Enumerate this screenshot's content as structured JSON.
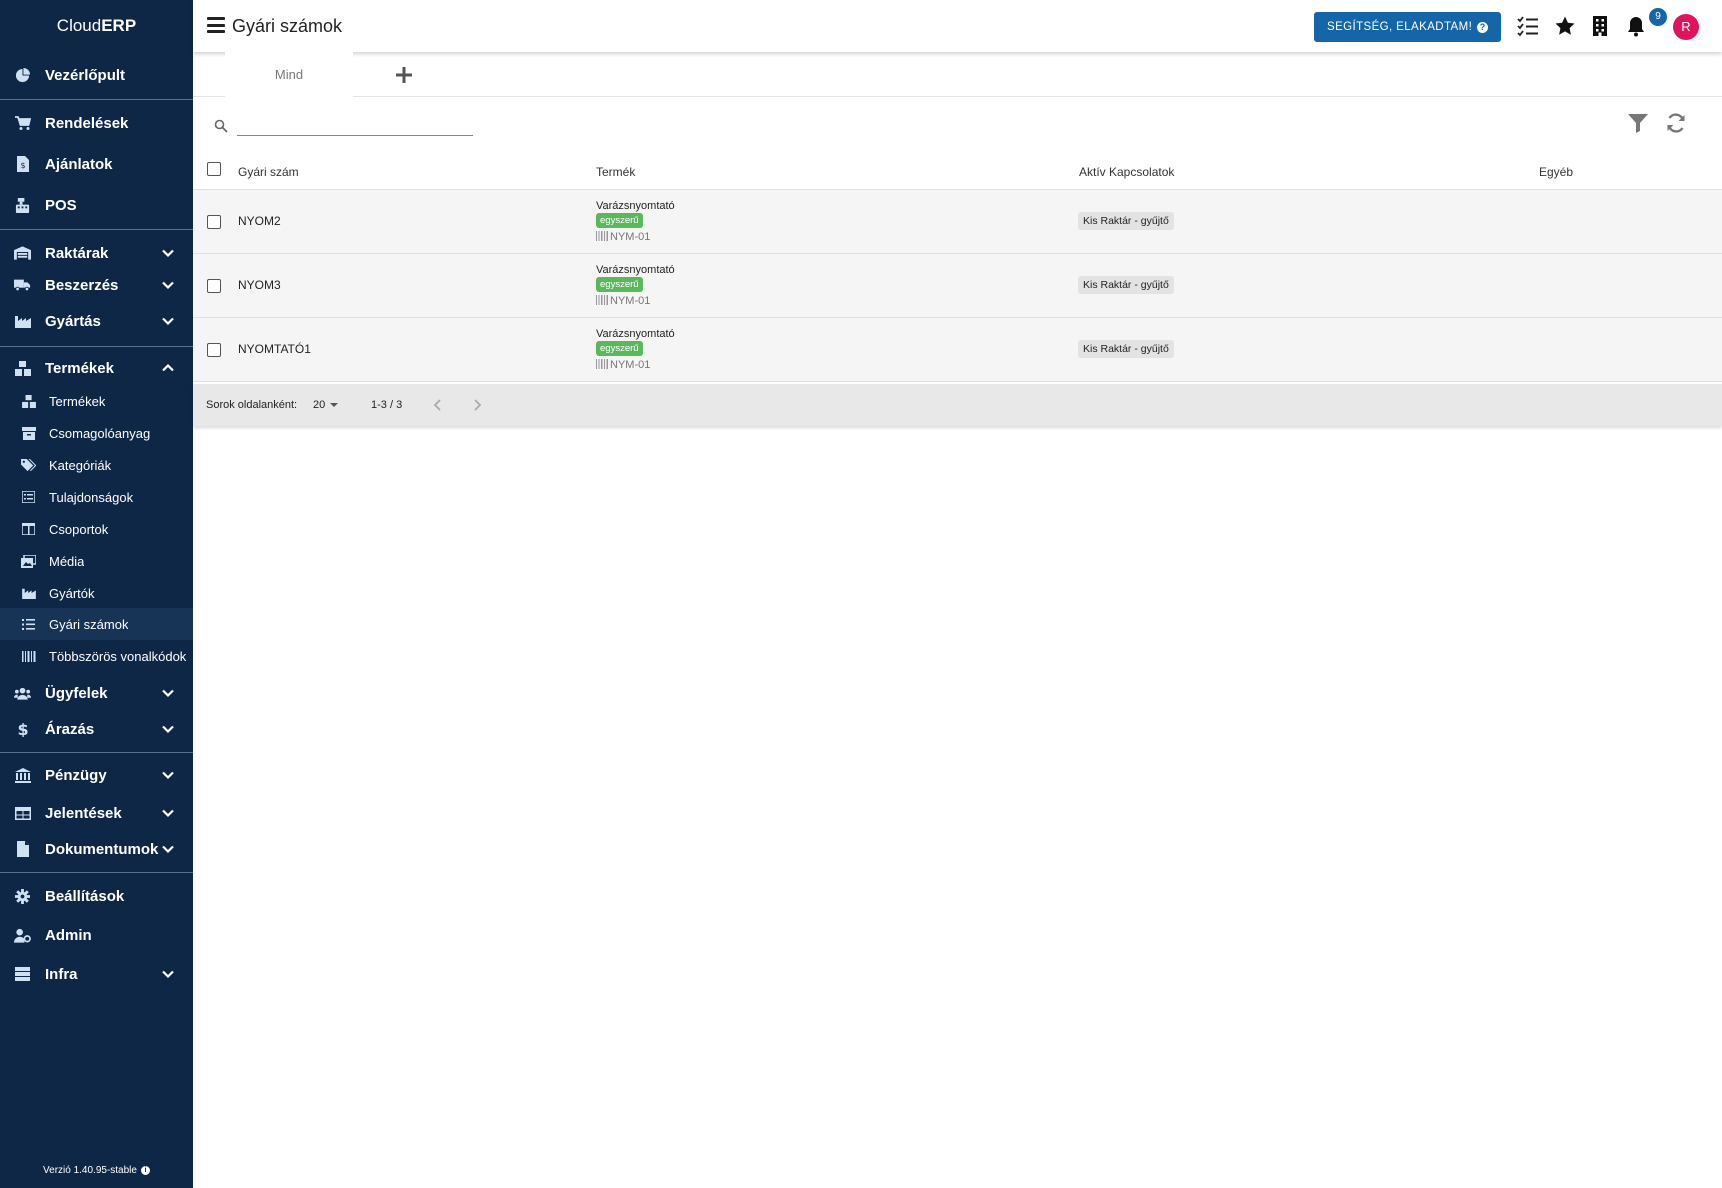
{
  "brand": {
    "prefix": "Cloud",
    "bold": "ERP"
  },
  "sidebar": {
    "items": [
      {
        "label": "Vezérlőpult"
      },
      {
        "label": "Rendelések"
      },
      {
        "label": "Ajánlatok"
      },
      {
        "label": "POS"
      },
      {
        "label": "Raktárak"
      },
      {
        "label": "Beszerzés"
      },
      {
        "label": "Gyártás"
      },
      {
        "label": "Termékek"
      },
      {
        "label": "Ügyfelek"
      },
      {
        "label": "Árazás"
      },
      {
        "label": "Pénzügy"
      },
      {
        "label": "Jelentések"
      },
      {
        "label": "Dokumentumok"
      },
      {
        "label": "Beállítások"
      },
      {
        "label": "Admin"
      },
      {
        "label": "Infra"
      }
    ],
    "sub_items": [
      {
        "label": "Termékek"
      },
      {
        "label": "Csomagolóanyag"
      },
      {
        "label": "Kategóriák"
      },
      {
        "label": "Tulajdonságok"
      },
      {
        "label": "Csoportok"
      },
      {
        "label": "Média"
      },
      {
        "label": "Gyártók"
      },
      {
        "label": "Gyári számok"
      },
      {
        "label": "Többszörös vonalkódok"
      }
    ],
    "version": "Verzió 1.40.95-stable"
  },
  "header": {
    "title": "Gyári számok",
    "help_label": "SEGÍTSÉG, ELAKADTAM!",
    "notification_count": "9",
    "avatar_letter": "R"
  },
  "tabs": [
    {
      "label": "Mind"
    }
  ],
  "search": {
    "placeholder": ""
  },
  "table": {
    "columns": [
      "Gyári szám",
      "Termék",
      "Aktív Kapcsolatok",
      "Egyéb"
    ],
    "rows": [
      {
        "serial": "NYOM2",
        "product": "Varázsnyomtató",
        "tag": "egyszerű",
        "sku": "NYM-01",
        "relation": "Kis Raktár - gyűjtő"
      },
      {
        "serial": "NYOM3",
        "product": "Varázsnyomtató",
        "tag": "egyszerű",
        "sku": "NYM-01",
        "relation": "Kis Raktár - gyűjtő"
      },
      {
        "serial": "NYOMTATÓ1",
        "product": "Varázsnyomtató",
        "tag": "egyszerű",
        "sku": "NYM-01",
        "relation": "Kis Raktár - gyűjtő"
      }
    ]
  },
  "pager": {
    "rows_per_page_label": "Sorok oldalanként:",
    "rows_per_page": "20",
    "range": "1-3 / 3"
  },
  "colors": {
    "sidebar": "#0f2747",
    "accent": "#1565a9",
    "tag": "#5cb85c",
    "avatar": "#e0145c"
  }
}
